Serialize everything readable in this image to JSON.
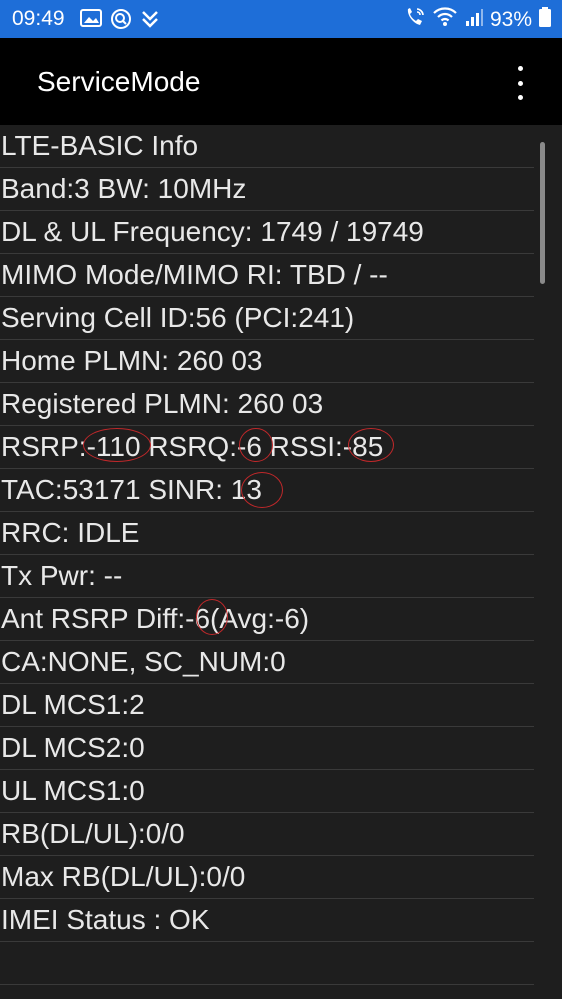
{
  "status_bar": {
    "time": "09:49",
    "battery": "93%",
    "icons_left": [
      "gallery-icon",
      "search-icon",
      "download-icon"
    ],
    "icons_right": [
      "wifi-calling-icon",
      "wifi-icon",
      "signal-icon",
      "battery-icon"
    ],
    "color": "#1e6ed8"
  },
  "app_bar": {
    "title": "ServiceMode",
    "menu_icon": "overflow-menu-icon"
  },
  "rows": [
    "LTE-BASIC Info",
    "Band:3 BW: 10MHz",
    "DL & UL Frequency: 1749 / 19749",
    "MIMO Mode/MIMO RI: TBD / --",
    "Serving Cell ID:56 (PCI:241)",
    "Home PLMN: 260 03",
    "Registered PLMN: 260 03",
    "RSRP:-110 RSRQ:-6 RSSI:-85",
    "TAC:53171 SINR: 13",
    "RRC: IDLE",
    "Tx Pwr: --",
    "Ant RSRP Diff:-6(Avg:-6)",
    "CA:NONE, SC_NUM:0",
    "DL MCS1:2",
    "DL MCS2:0",
    "UL MCS1:0",
    "RB(DL/UL):0/0",
    "Max RB(DL/UL):0/0",
    "IMEI Status : OK",
    ""
  ],
  "annotations": {
    "color": "#c0282a",
    "circled_values": [
      "-110",
      "-6",
      "-85",
      "13",
      "-6"
    ]
  }
}
